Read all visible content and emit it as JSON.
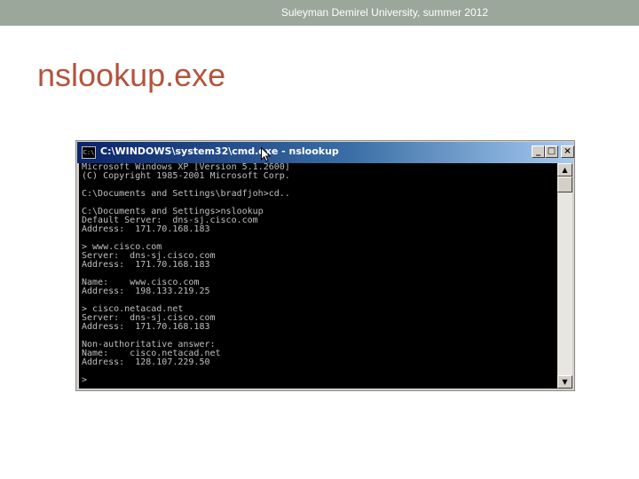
{
  "header": {
    "text": "Suleyman Demirel University, summer 2012"
  },
  "slide": {
    "title": "nslookup.exe"
  },
  "window": {
    "title": "C:\\WINDOWS\\system32\\cmd.exe - nslookup",
    "icon_label": "C:\\",
    "buttons": {
      "minimize": "_",
      "maximize": "□",
      "close": "×"
    },
    "scroll_up": "▲",
    "scroll_down": "▼"
  },
  "console": {
    "lines": [
      "Microsoft Windows XP [Version 5.1.2600]",
      "(C) Copyright 1985-2001 Microsoft Corp.",
      "",
      "C:\\Documents and Settings\\bradfjoh>cd..",
      "",
      "C:\\Documents and Settings>nslookup",
      "Default Server:  dns-sj.cisco.com",
      "Address:  171.70.168.183",
      "",
      "> www.cisco.com",
      "Server:  dns-sj.cisco.com",
      "Address:  171.70.168.183",
      "",
      "Name:    www.cisco.com",
      "Address:  198.133.219.25",
      "",
      "> cisco.netacad.net",
      "Server:  dns-sj.cisco.com",
      "Address:  171.70.168.183",
      "",
      "Non-authoritative answer:",
      "Name:    cisco.netacad.net",
      "Address:  128.107.229.50",
      "",
      ">"
    ]
  },
  "colors": {
    "header_bar": "#9aa79a",
    "title_text": "#b5533d",
    "console_bg": "#000000",
    "console_text": "#c0c0c0",
    "titlebar_start": "#0a246a",
    "titlebar_end": "#a6caf0"
  }
}
